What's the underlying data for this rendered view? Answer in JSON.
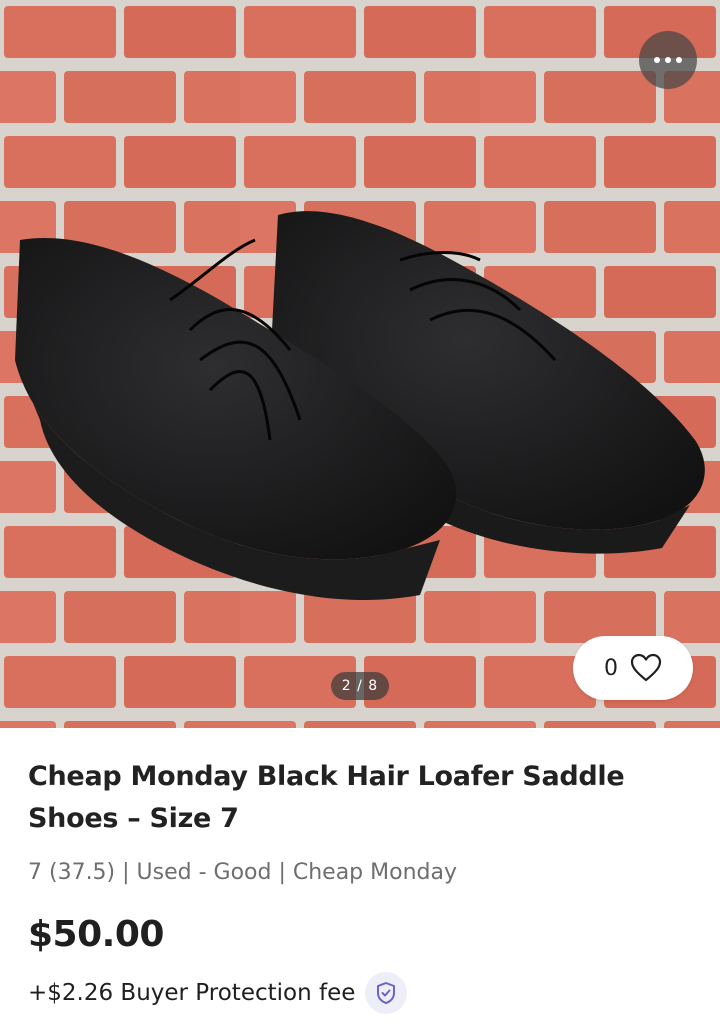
{
  "gallery": {
    "counter": "2 / 8",
    "current": 2,
    "total": 8,
    "more_icon": "more-dots-icon"
  },
  "like": {
    "count": "0",
    "icon": "heart-icon"
  },
  "listing": {
    "title": "Cheap Monday Black Hair Loafer Saddle Shoes – Size 7",
    "meta": "7 (37.5) | Used - Good | Cheap Monday",
    "price": "$50.00",
    "fee": "+$2.26 Buyer Protection fee",
    "fee_icon": "shield-check-icon"
  },
  "colors": {
    "accent": "#6b63c9",
    "text": "#1f1f1f",
    "muted": "#6e6e6e"
  }
}
